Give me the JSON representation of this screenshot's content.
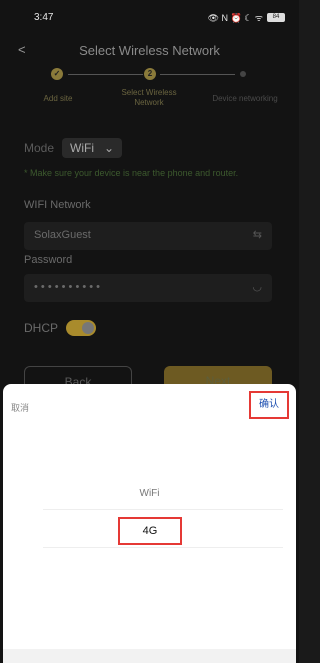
{
  "status": {
    "time": "3:47",
    "icons_text": "👁 N ⏰ ☾ ᯤ ",
    "battery": "84"
  },
  "header": {
    "title": "Select Wireless Network"
  },
  "stepper": {
    "steps": [
      {
        "label": "Add site",
        "state": "done",
        "marker": "✓"
      },
      {
        "label": "Select Wireless Network",
        "state": "current",
        "marker": "2"
      },
      {
        "label": "Device networking",
        "state": "pending",
        "marker": ""
      }
    ]
  },
  "form": {
    "mode_label": "Mode",
    "mode_value": "WiFi",
    "hint": "* Make sure your device is near the phone and router.",
    "wifi_label": "WIFI Network",
    "wifi_value": "SolaxGuest",
    "password_label": "Password",
    "password_value": "• • • • • • • • • •",
    "dhcp_label": "DHCP",
    "dhcp_on": true
  },
  "buttons": {
    "back": "Back",
    "next": "Next"
  },
  "sheet": {
    "cancel": "取消",
    "confirm": "确认",
    "options": [
      "WiFi",
      "4G"
    ],
    "selected": "4G"
  }
}
